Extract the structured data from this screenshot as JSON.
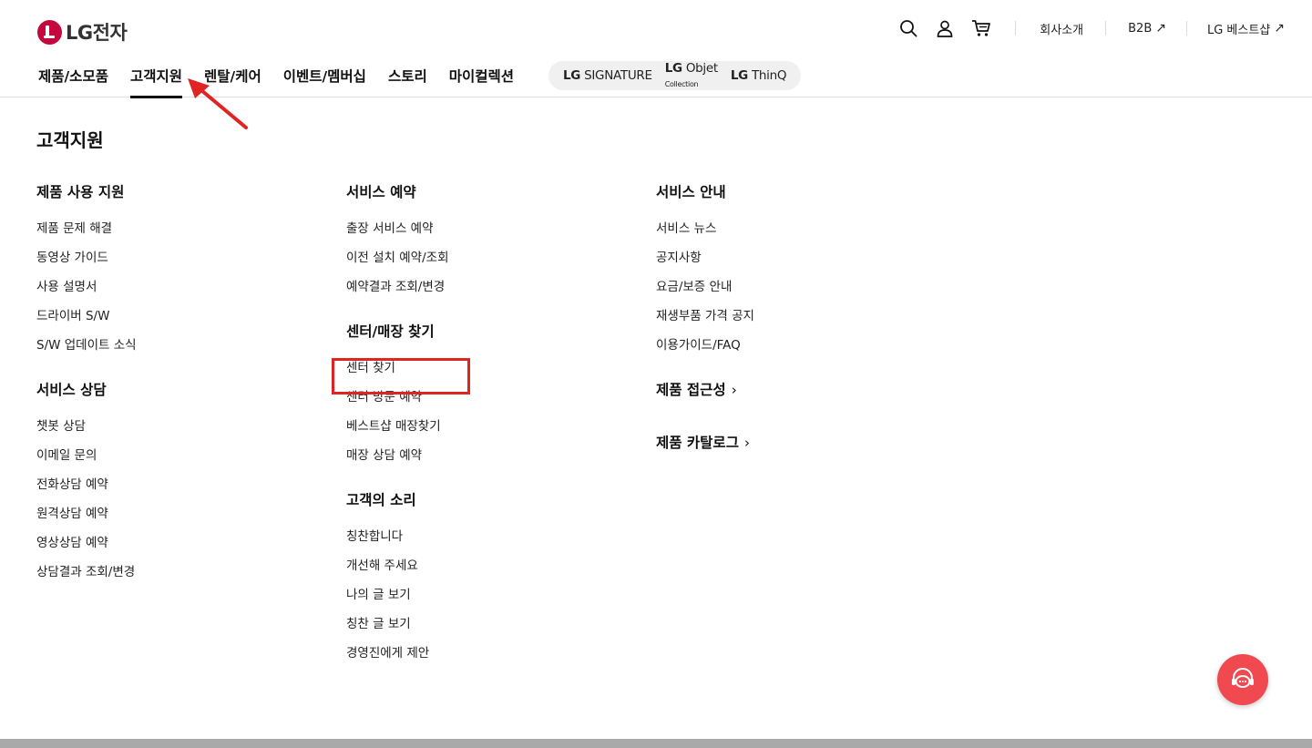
{
  "header": {
    "logo_text": "LG전자",
    "utility": {
      "search_icon": "search-icon",
      "user_icon": "user-icon",
      "cart_icon": "cart-icon",
      "company_label": "회사소개",
      "b2b_label": "B2B",
      "bestshop_label": "LG 베스트샵",
      "external_arrow": "↗"
    },
    "gnb": [
      {
        "label": "제품/소모품"
      },
      {
        "label": "고객지원"
      },
      {
        "label": "렌탈/케어"
      },
      {
        "label": "이벤트/멤버십"
      },
      {
        "label": "스토리"
      },
      {
        "label": "마이컬렉션"
      }
    ],
    "brands": {
      "signature_lg": "LG",
      "signature_name": "SIGNATURE",
      "objet_lg": "LG",
      "objet_name": "Objet",
      "objet_sub": "Collection",
      "thinq_lg": "LG",
      "thinq_name": "ThinQ"
    }
  },
  "menu": {
    "title": "고객지원",
    "col1": {
      "g1_title": "제품 사용 지원",
      "g1_links": [
        "제품 문제 해결",
        "동영상 가이드",
        "사용 설명서",
        "드라이버 S/W",
        "S/W 업데이트 소식"
      ],
      "g2_title": "서비스 상담",
      "g2_links": [
        "챗봇 상담",
        "이메일 문의",
        "전화상담 예약",
        "원격상담 예약",
        "영상상담 예약",
        "상담결과 조회/변경"
      ]
    },
    "col2": {
      "g1_title": "서비스 예약",
      "g1_links": [
        "출장 서비스 예약",
        "이전 설치 예약/조회",
        "예약결과 조회/변경"
      ],
      "g2_title": "센터/매장 찾기",
      "g2_links": [
        "센터 찾기",
        "센터 방문 예약",
        "베스트샵 매장찾기",
        "매장 상담 예약"
      ],
      "g3_title": "고객의 소리",
      "g3_links": [
        "칭찬합니다",
        "개선해 주세요",
        "나의 글 보기",
        "칭찬 글 보기",
        "경영진에게 제안"
      ]
    },
    "col3": {
      "g1_title": "서비스 안내",
      "g1_links": [
        "서비스 뉴스",
        "공지사항",
        "요금/보증 안내",
        "재생부품 가격 공지",
        "이용가이드/FAQ"
      ],
      "g2_title": "제품 접근성",
      "g3_title": "제품 카탈로그",
      "chevron": "›"
    }
  },
  "colors": {
    "highlight": "#e02424",
    "chat_button": "#f0494f",
    "logo": "#c4073d"
  },
  "chat_icon": "chat-agent-icon"
}
